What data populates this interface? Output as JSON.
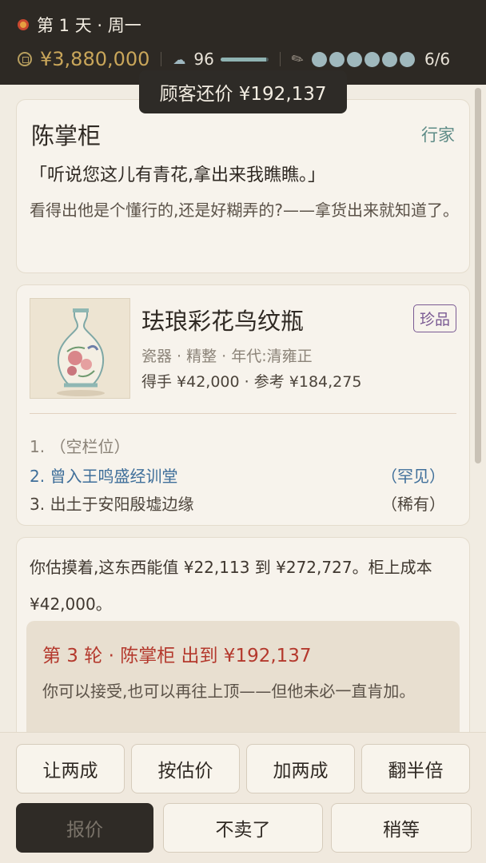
{
  "topbar": {
    "day_label": "第 1 天 · 周一",
    "money": "¥3,880,000",
    "reputation": "96",
    "reputation_level": 0.96,
    "stamina": "6/6",
    "stamina_count": 6,
    "icons": [
      "sun-icon",
      "coin-icon",
      "cloud-icon",
      "brush-icon"
    ]
  },
  "toast": {
    "text": "顾客还价 ¥192,137"
  },
  "customer": {
    "name": "陈掌柜",
    "tag": "行家",
    "quote": "「听说您这儿有青花,拿出来我瞧瞧。」",
    "description": "看得出他是个懂行的,还是好糊弄的?——拿货出来就知道了。"
  },
  "item": {
    "name": "珐琅彩花鸟纹瓶",
    "badge": "珍品",
    "meta": "瓷器 · 精整 · 年代:清雍正",
    "price": "得手 ¥42,000 · 参考 ¥184,275",
    "provenance": [
      {
        "label": "1. （空栏位）",
        "tag": ""
      },
      {
        "label": "2. 曾入王鸣盛经训堂",
        "tag": "（罕见）"
      },
      {
        "label": "3. 出土于安阳殷墟边缘",
        "tag": "（稀有）"
      }
    ]
  },
  "estimate": {
    "text": "你估摸着,这东西能值 ¥22,113 到 ¥272,727。柜上成本 ¥42,000。",
    "offer_title": "第 3 轮 · 陈掌柜 出到 ¥192,137",
    "offer_desc": "你可以接受,也可以再往上顶——但他未必一直肯加。"
  },
  "buttons": {
    "adjust": [
      "让两成",
      "按估价",
      "加两成",
      "翻半倍"
    ],
    "quote": "报价",
    "reject": "不卖了",
    "wait": "稍等"
  },
  "colors": {
    "topbar_bg": "#2d2924",
    "money": "#c9a65a",
    "offer_red": "#b4392d",
    "rare_purple": "#7a5a93",
    "link_blue": "#3f6f9a"
  }
}
